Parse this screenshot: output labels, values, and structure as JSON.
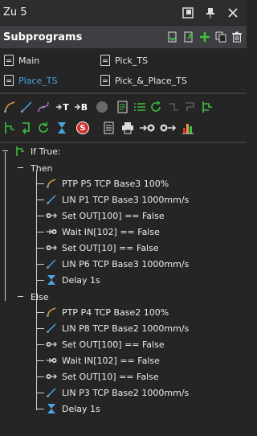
{
  "window": {
    "title": "Zu 5"
  },
  "subprograms": {
    "label": "Subprograms",
    "items": [
      {
        "label": "Main",
        "active": false
      },
      {
        "label": "Pick_TS",
        "active": false
      },
      {
        "label": "Place_TS",
        "active": true
      },
      {
        "label": "Pick_&_Place_TS",
        "active": false
      }
    ]
  },
  "toolbar": {
    "t_label": "T",
    "b_label": "B",
    "s_label": "S"
  },
  "tree": {
    "root_label": "If True:",
    "then_label": "Then",
    "else_label": "Else",
    "then_items": [
      {
        "icon": "ptp-move-icon",
        "label": "PTP P5 TCP Base3 100%"
      },
      {
        "icon": "lin-move-icon",
        "label": "LIN P1 TCP Base3 1000mm/s"
      },
      {
        "icon": "set-out-icon",
        "label": "Set OUT[100] == False"
      },
      {
        "icon": "wait-in-icon",
        "label": "Wait IN[102] == False"
      },
      {
        "icon": "set-out-icon",
        "label": "Set OUT[10] == False"
      },
      {
        "icon": "lin-move-icon",
        "label": "LIN P6 TCP Base3 1000mm/s"
      },
      {
        "icon": "delay-icon",
        "label": "Delay 1s"
      }
    ],
    "else_items": [
      {
        "icon": "ptp-move-icon",
        "label": "PTP P4 TCP Base2 100%"
      },
      {
        "icon": "lin-move-icon",
        "label": "LIN P8 TCP Base2 1000mm/s"
      },
      {
        "icon": "set-out-icon",
        "label": "Set OUT[100] == False"
      },
      {
        "icon": "wait-in-icon",
        "label": "Wait IN[102] == False"
      },
      {
        "icon": "set-out-icon",
        "label": "Set OUT[10] == False"
      },
      {
        "icon": "lin-move-icon",
        "label": "LIN P3 TCP Base2 1000mm/s"
      },
      {
        "icon": "delay-icon",
        "label": "Delay 1s"
      }
    ]
  },
  "colors": {
    "active_text": "#4aa3df",
    "green_icon": "#3fbf3f",
    "accent_orange": "#e0a040",
    "accent_blue": "#4aa3df"
  }
}
